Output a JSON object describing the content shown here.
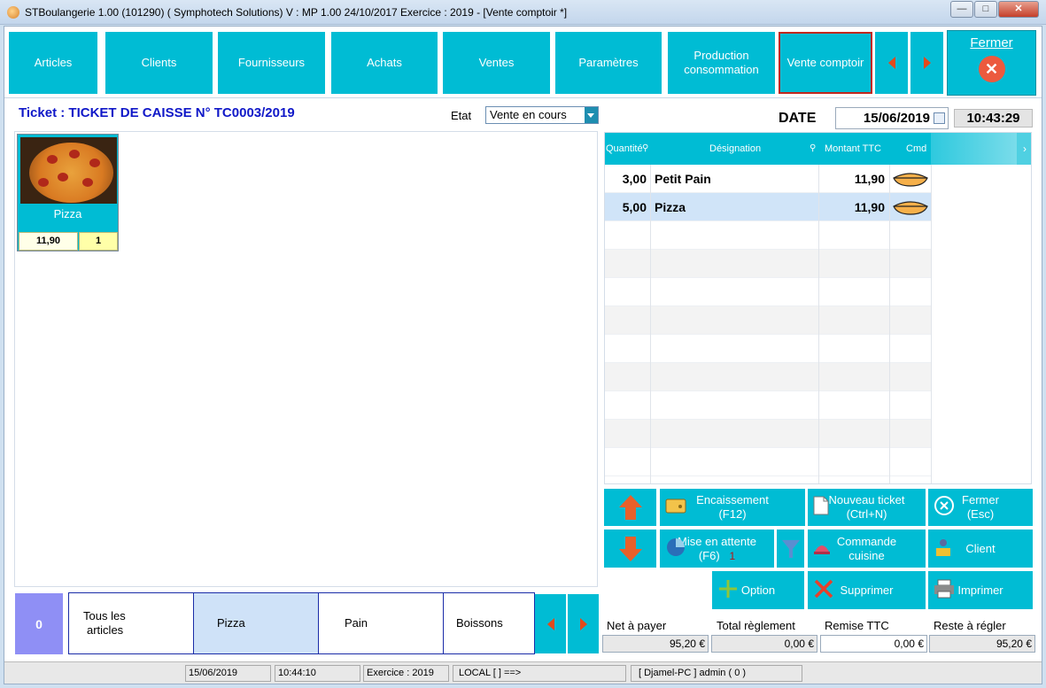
{
  "window": {
    "title": "STBoulangerie 1.00 (101290) ( Symphotech Solutions)  V : MP 1.00 24/10/2017 Exercice : 2019 - [Vente comptoir *]",
    "min": "—",
    "max": "□",
    "close": "✕"
  },
  "nav": {
    "articles": "Articles",
    "clients": "Clients",
    "fournisseurs": "Fournisseurs",
    "achats": "Achats",
    "ventes": "Ventes",
    "parametres": "Paramètres",
    "production_l1": "Production",
    "production_l2": "consommation",
    "vente_comptoir": "Vente comptoir",
    "fermer": "Fermer"
  },
  "ticket": {
    "title": "Ticket : TICKET DE CAISSE N° TC0003/2019",
    "etat_label": "Etat",
    "etat_value": "Vente en cours"
  },
  "article_card": {
    "name": "Pizza",
    "price": "11,90",
    "qty": "1"
  },
  "categories": {
    "count": "0",
    "tous_l1": "Tous les",
    "tous_l2": "articles",
    "pizza": "Pizza",
    "pain": "Pain",
    "boissons": "Boissons"
  },
  "header_date": {
    "label": "DATE",
    "date": "15/06/2019",
    "time": "10:43:29"
  },
  "grid": {
    "col_qty": "Quantité",
    "col_designation": "Désignation",
    "col_montant": "Montant TTC",
    "col_cmd": "Cmd",
    "rows": [
      {
        "qty": "3,00",
        "designation": "Petit Pain",
        "montant": "11,90"
      },
      {
        "qty": "5,00",
        "designation": "Pizza",
        "montant": "11,90"
      }
    ]
  },
  "actions": {
    "encaissement_l1": "Encaissement",
    "encaissement_l2": "(F12)",
    "nouveau_l1": "Nouveau ticket",
    "nouveau_l2": "(Ctrl+N)",
    "fermer_l1": "Fermer",
    "fermer_l2": "(Esc)",
    "attente_l1": "Mise en attente",
    "attente_l2": "(F6)",
    "attente_count": "1",
    "commande_l1": "Commande",
    "commande_l2": "cuisine",
    "client": "Client",
    "option": "Option",
    "supprimer": "Supprimer",
    "imprimer": "Imprimer"
  },
  "totals": {
    "net_label": "Net à payer",
    "net_value": "95,20 €",
    "total_label": "Total règlement",
    "total_value": "0,00 €",
    "remise_label": "Remise TTC",
    "remise_value": "0,00 €",
    "reste_label": "Reste à régler",
    "reste_value": "95,20 €"
  },
  "status": {
    "date": "15/06/2019",
    "time": "10:44:10",
    "exercice": "Exercice : 2019",
    "local": "LOCAL [  ] ==>",
    "user": "[ Djamel-PC ] admin ( 0 )"
  },
  "colors": {
    "accent": "#00bcd4",
    "title_blue": "#1018c8",
    "arrow": "#e34a1b"
  }
}
